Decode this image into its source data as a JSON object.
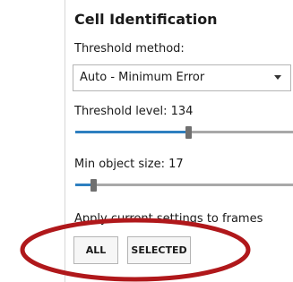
{
  "panel": {
    "title": "Cell Identification",
    "threshold_method": {
      "label": "Threshold method:",
      "selected": "Auto - Minimum Error"
    },
    "threshold_level": {
      "label": "Threshold level: 134",
      "value": 134,
      "fraction": 0.5
    },
    "min_object_size": {
      "label": "Min object size:   17",
      "value": 17,
      "fraction": 0.08
    },
    "apply": {
      "label": "Apply current settings to frames",
      "all_button": "ALL",
      "selected_button": "SELECTED"
    }
  },
  "colors": {
    "slider_fill": "#2d7fc0",
    "annotation_ellipse": "#b0181b"
  },
  "icons": {
    "dropdown": "chevron-down-icon"
  }
}
